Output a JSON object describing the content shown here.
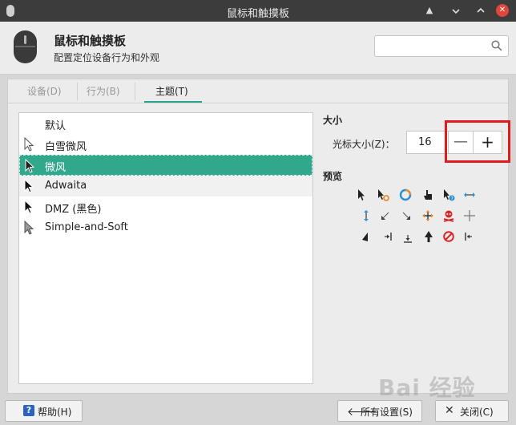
{
  "window": {
    "title": "鼠标和触摸板"
  },
  "header": {
    "title": "鼠标和触摸板",
    "subtitle": "配置定位设备行为和外观",
    "search_placeholder": ""
  },
  "tabs": [
    {
      "label": "设备(D)",
      "active": false
    },
    {
      "label": "行为(B)",
      "active": false
    },
    {
      "label": "主题(T)",
      "active": true
    }
  ],
  "themes": [
    {
      "label": "默认",
      "selected": false
    },
    {
      "label": "白雪微风",
      "selected": false
    },
    {
      "label": "微风",
      "selected": true
    },
    {
      "label": "Adwaita",
      "selected": false
    },
    {
      "label": "DMZ (黑色)",
      "selected": false
    },
    {
      "label": "Simple-and-Soft",
      "selected": false
    }
  ],
  "size": {
    "section_title": "大小",
    "label": "光标大小(Z)：",
    "value": "16",
    "minus": "—",
    "plus": "+"
  },
  "preview": {
    "section_title": "预览"
  },
  "buttons": {
    "help": "帮助(H)",
    "help_icon": "?",
    "all_settings": "所有设置(S)",
    "close": "关闭(C)"
  },
  "watermark": "Bai 经验",
  "colors": {
    "accent": "#31a88c",
    "highlight": "#e11b1b",
    "titlebar": "#3c3c3c"
  }
}
